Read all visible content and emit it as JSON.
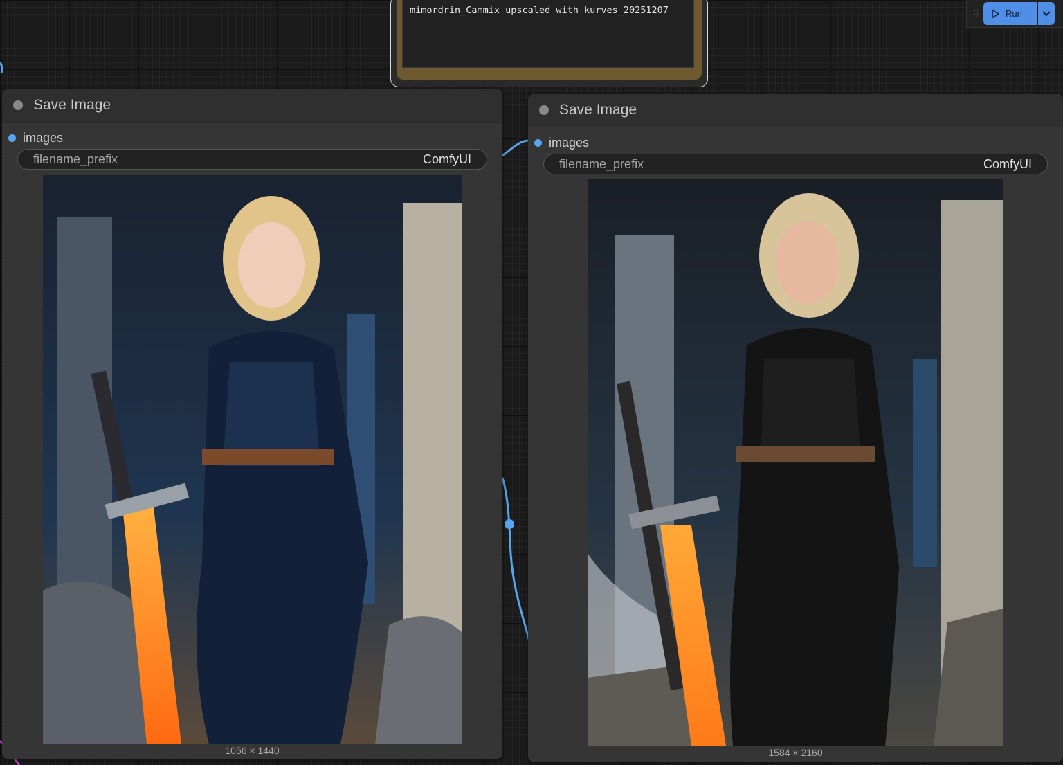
{
  "note": {
    "text": "mimordrin_Cammix upscaled with kurves_20251207"
  },
  "toolbar": {
    "run_label": "Run",
    "play_icon": "play-icon",
    "dropdown_icon": "chevron-down-icon"
  },
  "nodes": [
    {
      "title": "Save Image",
      "input_label": "images",
      "widget_name": "filename_prefix",
      "widget_value": "ComfyUI",
      "image_dims": "1056 × 1440"
    },
    {
      "title": "Save Image",
      "input_label": "images",
      "widget_name": "filename_prefix",
      "widget_value": "ComfyUI",
      "image_dims": "1584 × 2160"
    }
  ],
  "colors": {
    "canvas": "#1b1b1b",
    "node_body": "#353535",
    "link": "#58a6f0",
    "run_button": "#4f8fe8",
    "note_frame": "#6e5a2e"
  }
}
